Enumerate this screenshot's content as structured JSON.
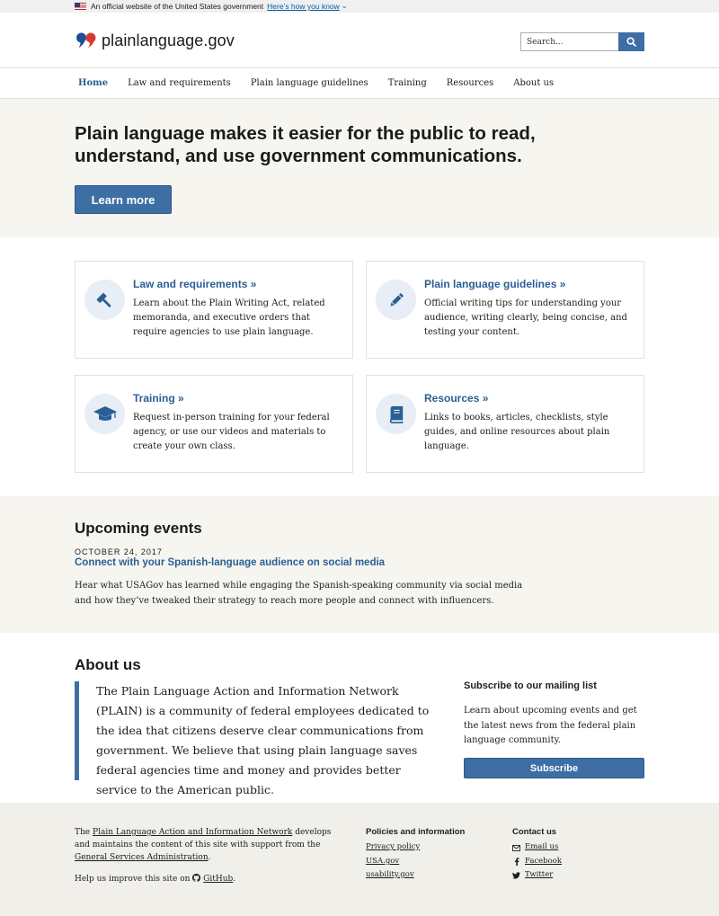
{
  "gov_banner": {
    "text": "An official website of the United States government",
    "link": "Here’s how you know"
  },
  "header": {
    "site_name": "plainlanguage.gov",
    "search_placeholder": "Search..."
  },
  "nav": {
    "items": [
      {
        "label": "Home"
      },
      {
        "label": "Law and requirements"
      },
      {
        "label": "Plain language guidelines"
      },
      {
        "label": "Training"
      },
      {
        "label": "Resources"
      },
      {
        "label": "About us"
      }
    ]
  },
  "hero": {
    "title": "Plain language makes it easier for the public to read, understand, and use government communications.",
    "button": "Learn more"
  },
  "cards": [
    {
      "icon": "gavel-icon",
      "title": "Law and requirements »",
      "text": "Learn about the Plain Writing Act, related memoranda, and executive orders that require agencies to use plain language."
    },
    {
      "icon": "pencil-icon",
      "title": "Plain language guidelines »",
      "text": "Official writing tips for understanding your audience, writing clearly, being concise, and testing your content."
    },
    {
      "icon": "graduation-cap-icon",
      "title": "Training »",
      "text": "Request in-person training for your federal agency, or use our videos and materials to create your own class."
    },
    {
      "icon": "book-icon",
      "title": "Resources »",
      "text": "Links to books, articles, checklists, style guides, and online resources about plain language."
    }
  ],
  "events": {
    "title": "Upcoming events",
    "date": "OCTOBER 24, 2017",
    "link": "Connect with your Spanish-language audience on social media",
    "description": "Hear what USAGov has learned while engaging the Spanish-speaking community via social media and how they’ve tweaked their strategy to reach more people and connect with influencers."
  },
  "about": {
    "title": "About us",
    "quote": "The Plain Language Action and Information Network (PLAIN) is a community of federal employees dedicated to the idea that citizens deserve clear communications from government. We believe that using plain language saves federal agencies time and money and provides better service to the American public."
  },
  "subscribe": {
    "title": "Subscribe to our mailing list",
    "text": "Learn about upcoming events and get the latest news from the federal plain language community.",
    "button": "Subscribe"
  },
  "footer": {
    "about_prefix": "The",
    "about_link1": "Plain Language Action and Information Network",
    "about_middle": "develops and maintains the content of this site with support from the",
    "about_link2": "General Services Administration",
    "about_suffix": ".",
    "github_prefix": "Help us improve this site on",
    "github_link": "GitHub",
    "github_suffix": ".",
    "policies": {
      "title": "Policies and information",
      "links": [
        "Privacy policy",
        "USA.gov",
        "usability.gov"
      ]
    },
    "contact": {
      "title": "Contact us",
      "links": [
        "Email us",
        "Facebook",
        "Twitter"
      ]
    }
  },
  "colors": {
    "primary": "#3d6ea4",
    "link": "#2a5f95",
    "hero_bg": "#f6f5f0",
    "footer_bg": "#f0efea"
  }
}
